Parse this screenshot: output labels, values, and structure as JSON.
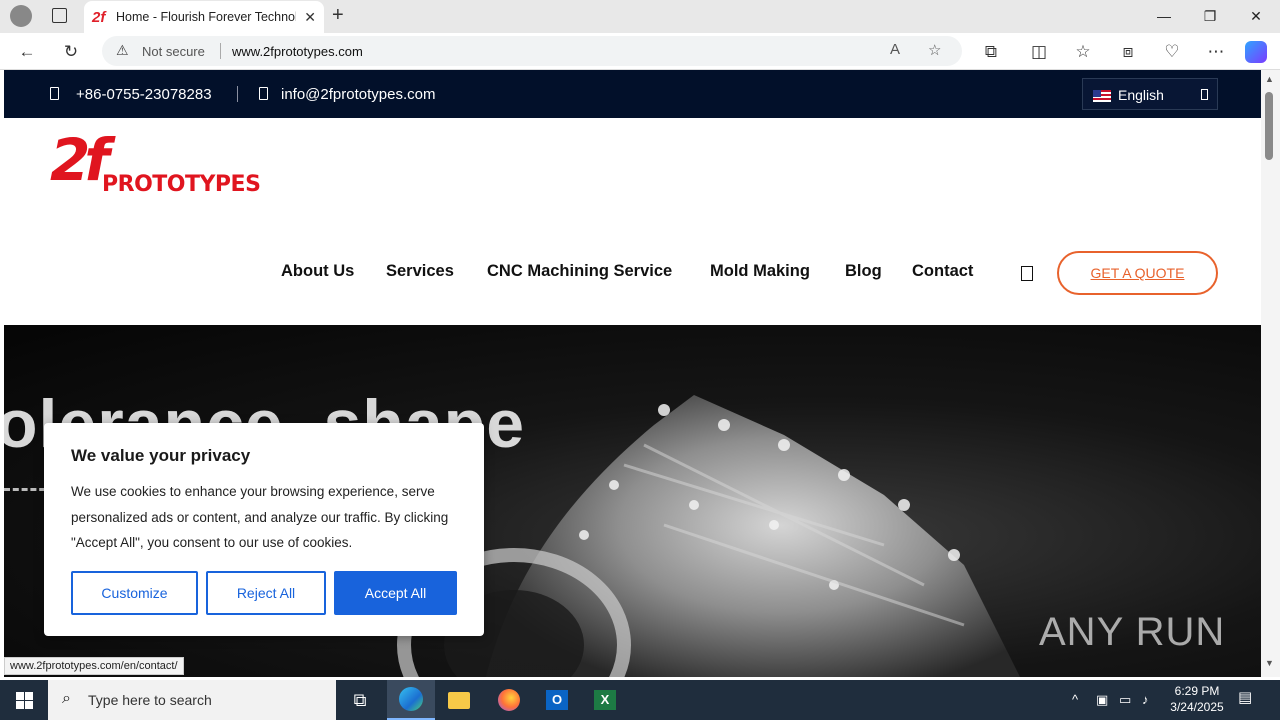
{
  "browser": {
    "tab_title": "Home - Flourish Forever Technol",
    "tab_favicon": "2f",
    "security_label": "Not secure",
    "url": "www.2fprototypes.com",
    "status_url": "www.2fprototypes.com/en/contact/"
  },
  "topbar": {
    "phone": "+86-0755-23078283",
    "email": "info@2fprototypes.com",
    "language": "English"
  },
  "logo": {
    "mark": "2f",
    "word": "PROTOTYPES"
  },
  "menu": {
    "items": [
      "About Us",
      "Services",
      "CNC Machining Service",
      "Mold Making",
      "Blog",
      "Contact"
    ],
    "quote_label": "GET A QUOTE"
  },
  "hero": {
    "title_fragment": "olerance, shape"
  },
  "cookie": {
    "title": "We value your privacy",
    "body": "We use cookies to enhance your browsing experience, serve personalized ads or content, and analyze our traffic. By clicking \"Accept All\", you consent to our use of cookies.",
    "customize": "Customize",
    "reject": "Reject All",
    "accept": "Accept All"
  },
  "watermark": "ANY RUN",
  "taskbar": {
    "search_placeholder": "Type here to search",
    "time": "6:29 PM",
    "date": "3/24/2025"
  },
  "colors": {
    "brand_red": "#e0151f",
    "accent_orange": "#e8622c",
    "cookie_blue": "#1863dc",
    "topbar_navy": "#02102a"
  }
}
